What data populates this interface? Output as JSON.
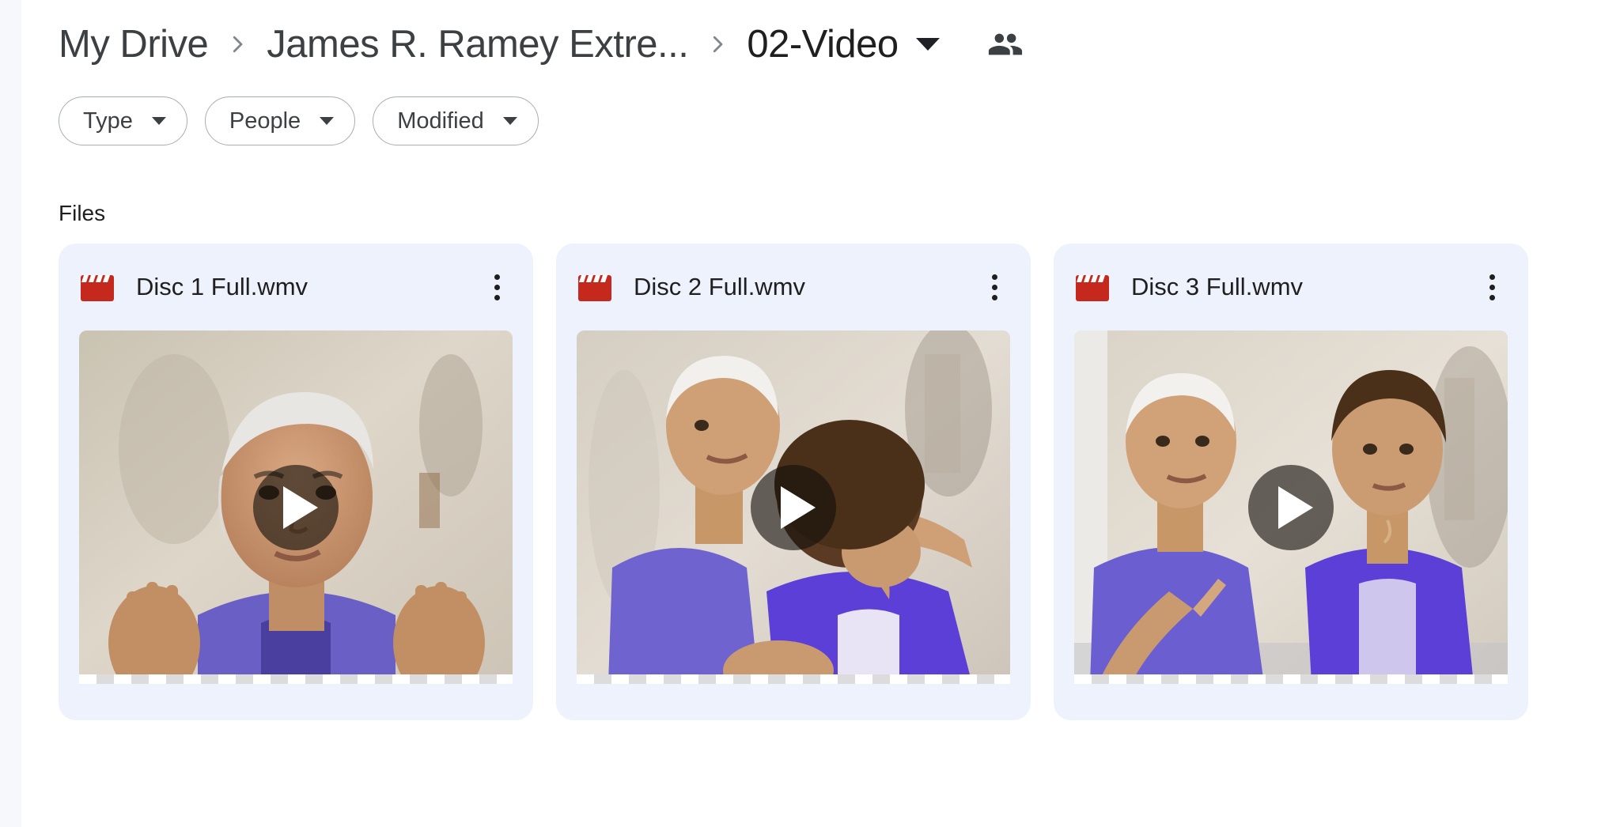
{
  "breadcrumb": {
    "items": [
      {
        "label": "My Drive"
      },
      {
        "label": "James R. Ramey Extre..."
      },
      {
        "label": "02-Video"
      }
    ],
    "separator_icon": "chevron-right-icon",
    "caret_icon": "caret-down-icon",
    "shared_icon": "people-shared-icon"
  },
  "filters": {
    "chips": [
      {
        "label": "Type",
        "icon": "caret-down-icon"
      },
      {
        "label": "People",
        "icon": "caret-down-icon"
      },
      {
        "label": "Modified",
        "icon": "caret-down-icon"
      }
    ]
  },
  "sections": {
    "files_label": "Files"
  },
  "files": [
    {
      "name": "Disc 1 Full.wmv",
      "type_icon": "video-clapperboard-icon",
      "type_icon_color": "#c5281c",
      "more_icon": "more-vert-icon",
      "play_icon": "play-triangle-icon",
      "thumbnail_alt": "Man with white hair in purple shirt gesturing with both hands"
    },
    {
      "name": "Disc 2 Full.wmv",
      "type_icon": "video-clapperboard-icon",
      "type_icon_color": "#c5281c",
      "more_icon": "more-vert-icon",
      "play_icon": "play-triangle-icon",
      "thumbnail_alt": "Man in purple shirt with arm around woman in purple cardigan leaning forward"
    },
    {
      "name": "Disc 3 Full.wmv",
      "type_icon": "video-clapperboard-icon",
      "type_icon_color": "#c5281c",
      "more_icon": "more-vert-icon",
      "play_icon": "play-triangle-icon",
      "thumbnail_alt": "Man in purple shirt pointing beside woman in purple blouse"
    }
  ],
  "colors": {
    "card_background": "#eef2fd",
    "page_background": "#ffffff",
    "sidebar_strip": "#f6f8fc",
    "text_primary": "#1f1f1f",
    "text_secondary": "#3c4043",
    "chip_border": "#a8adb3"
  }
}
